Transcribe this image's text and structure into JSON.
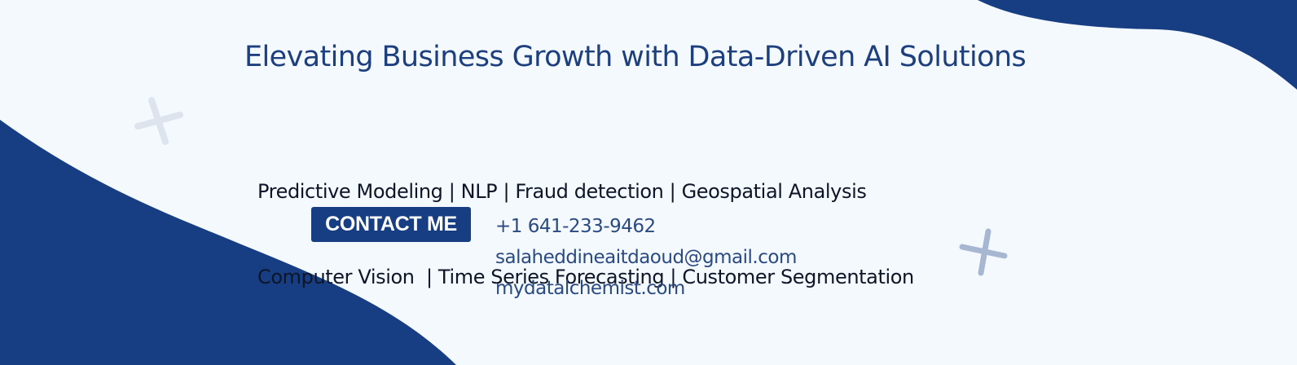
{
  "banner": {
    "headline": "Elevating Business Growth with Data-Driven AI Solutions",
    "services": [
      "Predictive Modeling | NLP | Fraud detection | Geospatial Analysis",
      "Computer Vision  | Time Series Forecasting | Customer Segmentation"
    ],
    "contact_button_label": "CONTACT ME",
    "contact": {
      "phone": "+1 641-233-9462",
      "email": "salaheddineaitdaoud@gmail.com",
      "website": "mydatalchemist.com"
    },
    "colors": {
      "background": "#f4f9fe",
      "accent": "#173e82",
      "headline": "#1e3f7d",
      "body_text": "#0e1526",
      "contact_text": "#2b4a82",
      "cross_light": "#dde4ee",
      "cross_dark": "#a7b7d2"
    },
    "decorations": [
      "cross-icon",
      "cross-icon"
    ]
  }
}
